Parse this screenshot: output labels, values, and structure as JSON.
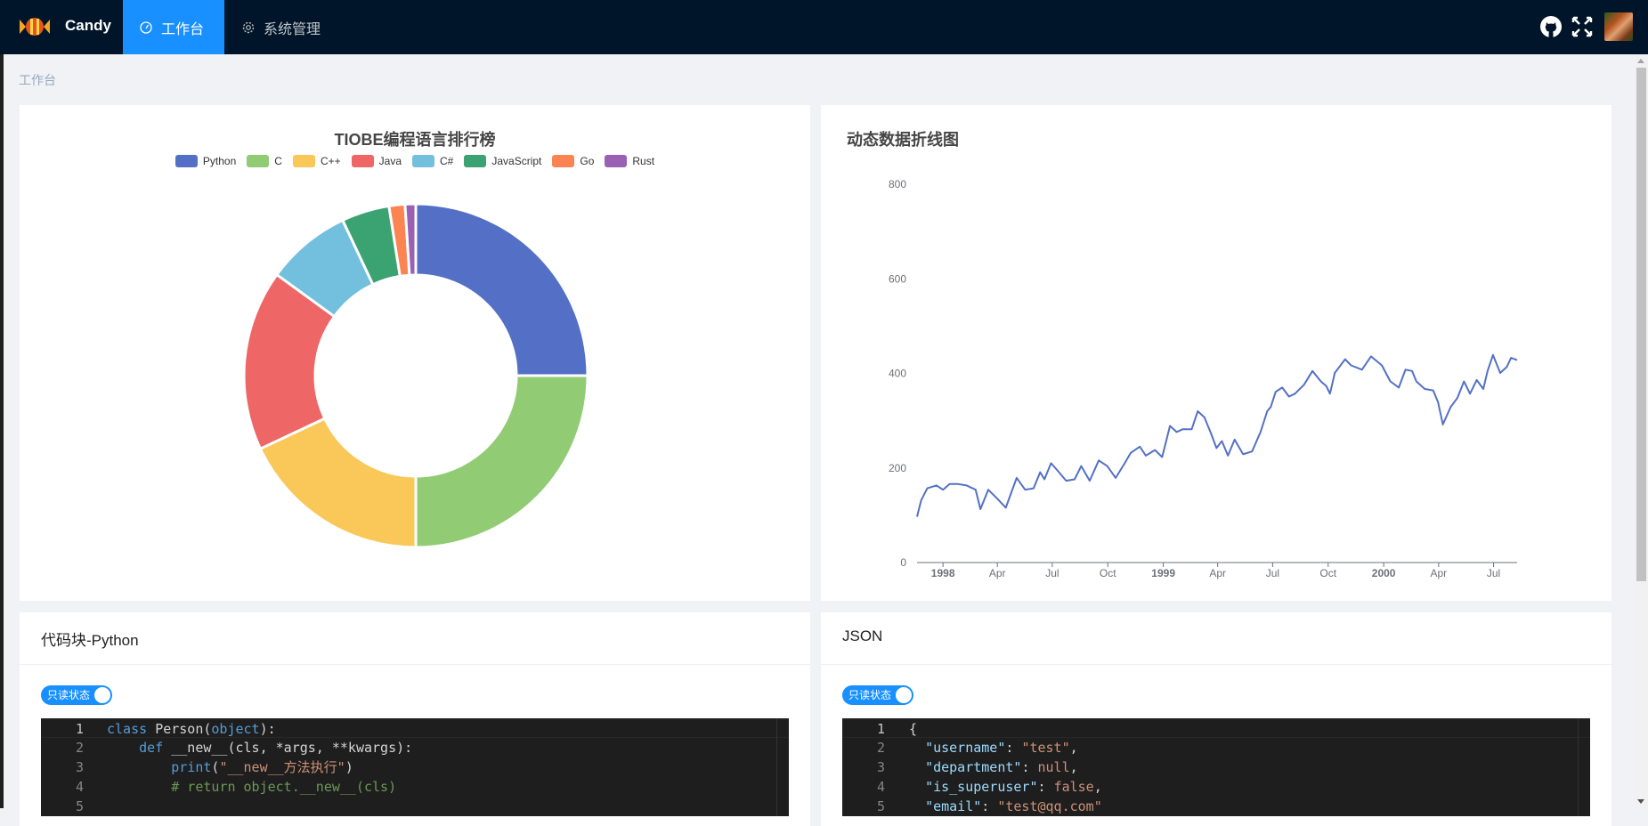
{
  "header": {
    "brand": "Candy",
    "menu": [
      {
        "label": "工作台",
        "icon": "dashboard-icon",
        "active": true
      },
      {
        "label": "系统管理",
        "icon": "gear-icon",
        "active": false
      }
    ],
    "right_icons": [
      "github-icon",
      "fullscreen-icon",
      "avatar"
    ],
    "active_color": "#1890ff",
    "bg_color": "#001529"
  },
  "breadcrumb": "工作台",
  "pie_card": {
    "legend": [
      "Python",
      "C",
      "C++",
      "Java",
      "C#",
      "JavaScript",
      "Go",
      "Rust"
    ]
  },
  "line_card": {
    "title": "动态数据折线图"
  },
  "code_card": {
    "title": "代码块-Python",
    "toggle_label": "只读状态",
    "lines": [
      [
        {
          "t": "class ",
          "c": "kw"
        },
        {
          "t": "Person("
        },
        {
          "t": "object",
          "c": "kw"
        },
        {
          "t": "):"
        }
      ],
      [
        {
          "t": "    "
        },
        {
          "t": "def ",
          "c": "kw"
        },
        {
          "t": "__new__(cls, *args, **kwargs):"
        }
      ],
      [
        {
          "t": "        "
        },
        {
          "t": "print",
          "c": "fn"
        },
        {
          "t": "("
        },
        {
          "t": "\"__new__方法执行\"",
          "c": "str"
        },
        {
          "t": ")"
        }
      ],
      [
        {
          "t": "        "
        },
        {
          "t": "# return object.__new__(cls)",
          "c": "cm"
        }
      ],
      [
        {
          "t": ""
        }
      ]
    ]
  },
  "json_card": {
    "title": "JSON",
    "toggle_label": "只读状态",
    "lines": [
      [
        {
          "t": "{"
        }
      ],
      [
        {
          "t": "  "
        },
        {
          "t": "\"username\"",
          "c": "key"
        },
        {
          "t": ": "
        },
        {
          "t": "\"test\"",
          "c": "str"
        },
        {
          "t": ","
        }
      ],
      [
        {
          "t": "  "
        },
        {
          "t": "\"department\"",
          "c": "key"
        },
        {
          "t": ": "
        },
        {
          "t": "null",
          "c": "str"
        },
        {
          "t": ","
        }
      ],
      [
        {
          "t": "  "
        },
        {
          "t": "\"is_superuser\"",
          "c": "key"
        },
        {
          "t": ": "
        },
        {
          "t": "false",
          "c": "str"
        },
        {
          "t": ","
        }
      ],
      [
        {
          "t": "  "
        },
        {
          "t": "\"email\"",
          "c": "key"
        },
        {
          "t": ": "
        },
        {
          "t": "\"test@qq.com\"",
          "c": "str"
        }
      ]
    ]
  },
  "chart_data": [
    {
      "type": "pie",
      "title": "TIOBE编程语言排行榜",
      "donut": true,
      "legend_position": "top",
      "categories": [
        "Python",
        "C",
        "C++",
        "Java",
        "C#",
        "JavaScript",
        "Go",
        "Rust"
      ],
      "values": [
        25,
        25,
        18,
        17,
        8,
        4.5,
        1.5,
        1
      ],
      "colors": [
        "#5470c6",
        "#91cc75",
        "#fac858",
        "#ee6666",
        "#73c0de",
        "#3ba272",
        "#fc8452",
        "#9a60b4"
      ]
    },
    {
      "type": "line",
      "title": "动态数据折线图",
      "color": "#5470c6",
      "ylim": [
        0,
        800
      ],
      "yticks": [
        0,
        200,
        400,
        600,
        800
      ],
      "xticks": [
        "1998",
        "Apr",
        "Jul",
        "Oct",
        "1999",
        "Apr",
        "Jul",
        "Oct",
        "2000",
        "Apr",
        "Jul"
      ],
      "xlim": [
        "1997-11-19",
        "2000-08-09"
      ],
      "grid": false,
      "points": [
        [
          "1997-11-19",
          97
        ],
        [
          "1997-11-26",
          132
        ],
        [
          "1997-12-06",
          157
        ],
        [
          "1997-12-21",
          163
        ],
        [
          "1998-01-01",
          154
        ],
        [
          "1998-01-12",
          166
        ],
        [
          "1998-01-26",
          166
        ],
        [
          "1998-02-09",
          163
        ],
        [
          "1998-02-24",
          154
        ],
        [
          "1998-03-04",
          113
        ],
        [
          "1998-03-17",
          154
        ],
        [
          "1998-04-01",
          135
        ],
        [
          "1998-04-15",
          116
        ],
        [
          "1998-05-03",
          179
        ],
        [
          "1998-05-17",
          154
        ],
        [
          "1998-05-31",
          157
        ],
        [
          "1998-06-11",
          191
        ],
        [
          "1998-06-18",
          176
        ],
        [
          "1998-06-29",
          210
        ],
        [
          "1998-07-10",
          194
        ],
        [
          "1998-07-24",
          173
        ],
        [
          "1998-08-07",
          176
        ],
        [
          "1998-08-18",
          204
        ],
        [
          "1998-09-01",
          173
        ],
        [
          "1998-09-16",
          216
        ],
        [
          "1998-09-30",
          204
        ],
        [
          "1998-10-14",
          179
        ],
        [
          "1998-10-29",
          210
        ],
        [
          "1998-11-08",
          232
        ],
        [
          "1998-11-23",
          245
        ],
        [
          "1998-12-03",
          226
        ],
        [
          "1998-12-18",
          238
        ],
        [
          "1998-12-30",
          223
        ],
        [
          "1999-01-12",
          289
        ],
        [
          "1999-01-23",
          276
        ],
        [
          "1999-02-02",
          282
        ],
        [
          "1999-02-17",
          282
        ],
        [
          "1999-02-27",
          320
        ],
        [
          "1999-03-10",
          307
        ],
        [
          "1999-03-21",
          273
        ],
        [
          "1999-03-30",
          242
        ],
        [
          "1999-04-08",
          257
        ],
        [
          "1999-04-18",
          226
        ],
        [
          "1999-04-29",
          260
        ],
        [
          "1999-05-13",
          229
        ],
        [
          "1999-05-28",
          235
        ],
        [
          "1999-06-11",
          276
        ],
        [
          "1999-06-22",
          320
        ],
        [
          "1999-06-28",
          329
        ],
        [
          "1999-07-06",
          361
        ],
        [
          "1999-07-17",
          370
        ],
        [
          "1999-07-28",
          351
        ],
        [
          "1999-08-07",
          357
        ],
        [
          "1999-08-22",
          376
        ],
        [
          "1999-09-05",
          405
        ],
        [
          "1999-09-19",
          383
        ],
        [
          "1999-09-28",
          373
        ],
        [
          "1999-10-04",
          357
        ],
        [
          "1999-10-12",
          401
        ],
        [
          "1999-10-29",
          430
        ],
        [
          "1999-11-08",
          417
        ],
        [
          "1999-11-26",
          408
        ],
        [
          "1999-12-11",
          436
        ],
        [
          "1999-12-29",
          417
        ],
        [
          "2000-01-12",
          383
        ],
        [
          "2000-01-26",
          370
        ],
        [
          "2000-02-06",
          408
        ],
        [
          "2000-02-17",
          405
        ],
        [
          "2000-02-24",
          383
        ],
        [
          "2000-03-09",
          367
        ],
        [
          "2000-03-23",
          364
        ],
        [
          "2000-03-31",
          339
        ],
        [
          "2000-04-08",
          292
        ],
        [
          "2000-04-21",
          329
        ],
        [
          "2000-05-02",
          348
        ],
        [
          "2000-05-13",
          383
        ],
        [
          "2000-05-23",
          357
        ],
        [
          "2000-06-03",
          386
        ],
        [
          "2000-06-14",
          367
        ],
        [
          "2000-06-21",
          405
        ],
        [
          "2000-06-30",
          439
        ],
        [
          "2000-07-12",
          401
        ],
        [
          "2000-07-23",
          414
        ],
        [
          "2000-07-30",
          433
        ],
        [
          "2000-08-09",
          428
        ]
      ]
    }
  ]
}
